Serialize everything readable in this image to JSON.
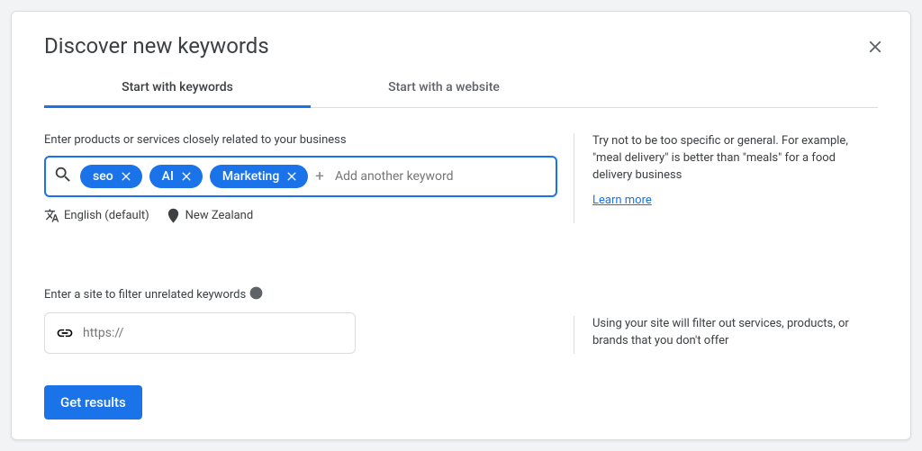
{
  "title": "Discover new keywords",
  "tabs": {
    "keywords": "Start with keywords",
    "website": "Start with a website"
  },
  "keywords_section": {
    "label": "Enter products or services closely related to your business",
    "chips": [
      "seo",
      "AI",
      "Marketing"
    ],
    "add_placeholder": "Add another keyword",
    "language_icon_label": "translate-icon",
    "language": "English (default)",
    "location_icon_label": "location-icon",
    "location": "New Zealand",
    "hint": "Try not to be too specific or general. For example, \"meal delivery\" is better than \"meals\" for a food delivery business",
    "learn_more": "Learn more"
  },
  "site_section": {
    "label": "Enter a site to filter unrelated keywords",
    "prefix": "https://",
    "hint": "Using your site will filter out services, products, or brands that you don't offer"
  },
  "submit_label": "Get results"
}
